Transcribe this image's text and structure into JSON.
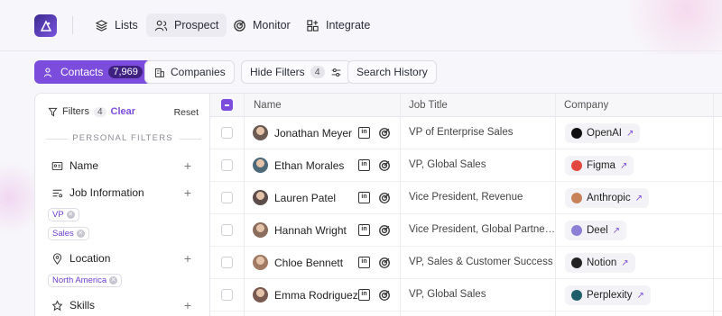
{
  "nav": {
    "items": [
      {
        "label": "Lists",
        "icon": "stack-icon"
      },
      {
        "label": "Prospect",
        "icon": "users-icon"
      },
      {
        "label": "Monitor",
        "icon": "target-icon"
      },
      {
        "label": "Integrate",
        "icon": "grid-plus-icon"
      }
    ]
  },
  "toolbar": {
    "contacts_label": "Contacts",
    "contacts_count": "7,969",
    "companies_label": "Companies",
    "hide_filters_label": "Hide Filters",
    "hide_filters_count": "4",
    "search_history_label": "Search History"
  },
  "filters": {
    "title": "Filters",
    "count": "4",
    "clear": "Clear",
    "reset": "Reset",
    "section": "PERSONAL FILTERS",
    "groups": [
      {
        "label": "Name",
        "icon": "id-card-icon"
      },
      {
        "label": "Job Information",
        "icon": "list-icon",
        "chips": [
          "VP",
          "Sales"
        ]
      },
      {
        "label": "Location",
        "icon": "pin-icon",
        "chips": [
          "North America"
        ]
      },
      {
        "label": "Skills",
        "icon": "skills-icon"
      }
    ]
  },
  "table": {
    "headers": [
      "Name",
      "Job Title",
      "Company"
    ],
    "rows": [
      {
        "name": "Jonathan Meyer",
        "job": "VP of Enterprise Sales",
        "company": "OpenAI",
        "logo_color": "#111111"
      },
      {
        "name": "Ethan Morales",
        "job": "VP, Global Sales",
        "company": "Figma",
        "logo_color": "#e2483d"
      },
      {
        "name": "Lauren Patel",
        "job": "Vice President, Revenue",
        "company": "Anthropic",
        "logo_color": "#c8825a"
      },
      {
        "name": "Hannah Wright",
        "job": "Vice President, Global Partne…",
        "company": "Deel",
        "logo_color": "#8b7fd6"
      },
      {
        "name": "Chloe Bennett",
        "job": "VP, Sales & Customer Success",
        "company": "Notion",
        "logo_color": "#222222"
      },
      {
        "name": "Emma Rodriguez",
        "job": "VP, Global Sales",
        "company": "Perplexity",
        "logo_color": "#1f5f6b"
      }
    ]
  },
  "colors": {
    "accent": "#7c4ddc"
  }
}
